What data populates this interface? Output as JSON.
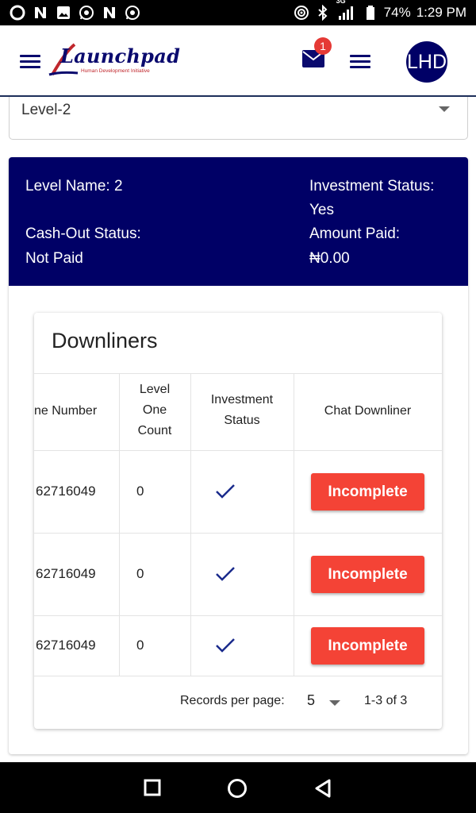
{
  "status_bar": {
    "battery": "74%",
    "time": "1:29 PM",
    "network": "3G",
    "icons": [
      "opera-icon",
      "n-icon",
      "gallery-icon",
      "whatsapp-icon",
      "n-icon",
      "whatsapp-icon",
      "hotspot-icon",
      "bluetooth-icon",
      "signal-icon",
      "battery-icon"
    ]
  },
  "app_bar": {
    "logo_text": "Launchpad",
    "logo_subtitle": "Human Development Initiative",
    "mail_badge": "1",
    "avatar_initials": "LHD",
    "icons": [
      "menu-icon",
      "mail-icon",
      "menu-icon"
    ]
  },
  "level_select": {
    "value": "Level-2"
  },
  "info": {
    "level_name": "Level Name: 2",
    "investment_status_label": "Investment Status:",
    "investment_status_value": "Yes",
    "cashout_status_label": "Cash-Out Status:",
    "cashout_status_value": "Not Paid",
    "amount_paid_label": "Amount Paid:",
    "amount_paid_value": "₦0.00"
  },
  "downliners": {
    "title": "Downliners",
    "columns": [
      "ne Number",
      "Level One Count",
      "Investment Status",
      "Chat Downliner"
    ],
    "column_lines": [
      [
        "ne Number"
      ],
      [
        "Level",
        "One",
        "Count"
      ],
      [
        "Investment",
        "Status"
      ],
      [
        "Chat Downliner"
      ]
    ],
    "rows": [
      {
        "phone": "62716049",
        "count": "0",
        "status_icon": "check-icon",
        "action": "Incomplete"
      },
      {
        "phone": "62716049",
        "count": "0",
        "status_icon": "check-icon",
        "action": "Incomplete"
      },
      {
        "phone": "62716049",
        "count": "0",
        "status_icon": "check-icon",
        "action": "Incomplete"
      }
    ],
    "pagination": {
      "label": "Records per page:",
      "per_page": "5",
      "range": "1-3 of 3"
    }
  },
  "colors": {
    "navy": "#000066",
    "button_red": "#f44336",
    "badge_red": "#e53935",
    "check_blue": "#1a2b8c"
  }
}
